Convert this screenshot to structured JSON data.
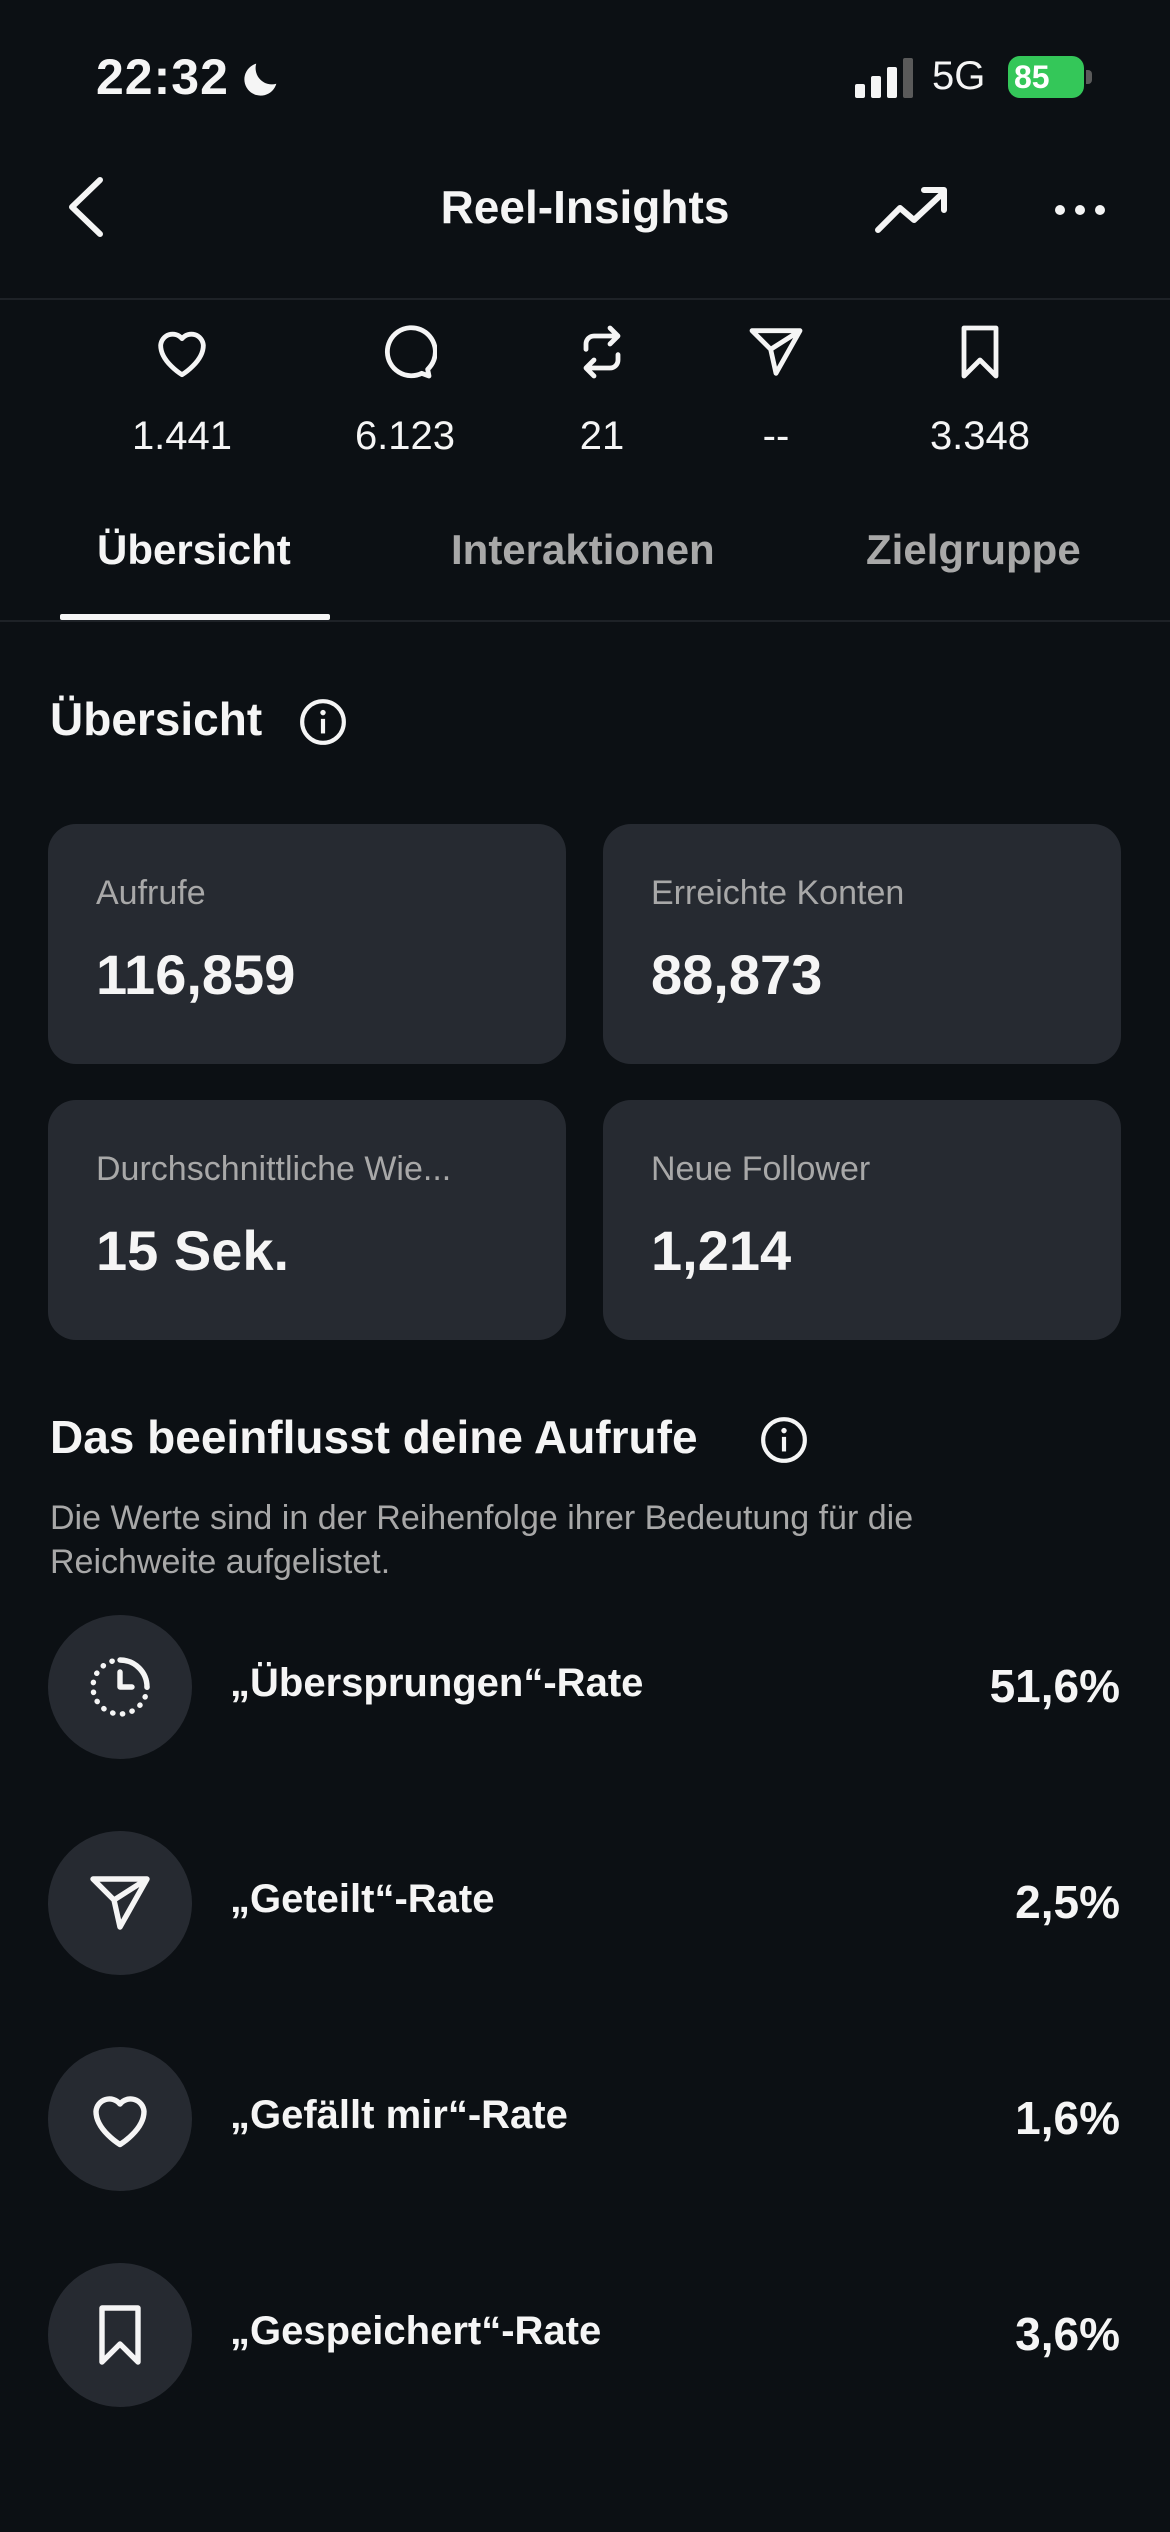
{
  "status": {
    "time": "22:32",
    "network": "5G",
    "battery": "85"
  },
  "header": {
    "title": "Reel-Insights"
  },
  "stats": [
    {
      "icon": "heart-icon",
      "value": "1.441"
    },
    {
      "icon": "comment-icon",
      "value": "6.123"
    },
    {
      "icon": "repost-icon",
      "value": "21"
    },
    {
      "icon": "share-icon",
      "value": "--"
    },
    {
      "icon": "bookmark-icon",
      "value": "3.348"
    }
  ],
  "tabs": [
    {
      "label": "Übersicht",
      "active": true
    },
    {
      "label": "Interaktionen",
      "active": false
    },
    {
      "label": "Zielgruppe",
      "active": false
    }
  ],
  "overview": {
    "title": "Übersicht",
    "cards": [
      {
        "label": "Aufrufe",
        "value": "116,859"
      },
      {
        "label": "Erreichte Konten",
        "value": "88,873"
      },
      {
        "label": "Durchschnittliche Wie...",
        "value": "15 Sek."
      },
      {
        "label": "Neue Follower",
        "value": "1,214"
      }
    ]
  },
  "influence": {
    "title": "Das beeinflusst deine Aufrufe",
    "subtitle": "Die Werte sind in der Reihenfolge ihrer Bedeutung für die Reichweite aufgelistet.",
    "rows": [
      {
        "icon": "skip-timer-icon",
        "label": "„Übersprungen“-Rate",
        "value": "51,6%"
      },
      {
        "icon": "share-icon",
        "label": "„Geteilt“-Rate",
        "value": "2,5%"
      },
      {
        "icon": "heart-icon",
        "label": "„Gefällt mir“-Rate",
        "value": "1,6%"
      },
      {
        "icon": "bookmark-icon",
        "label": "„Gespeichert“-Rate",
        "value": "3,6%"
      }
    ]
  },
  "colors": {
    "background": "#0c1014",
    "card": "#262a31",
    "text": "#f5f5f5",
    "muted": "#a8a8a8",
    "battery": "#34c759"
  }
}
